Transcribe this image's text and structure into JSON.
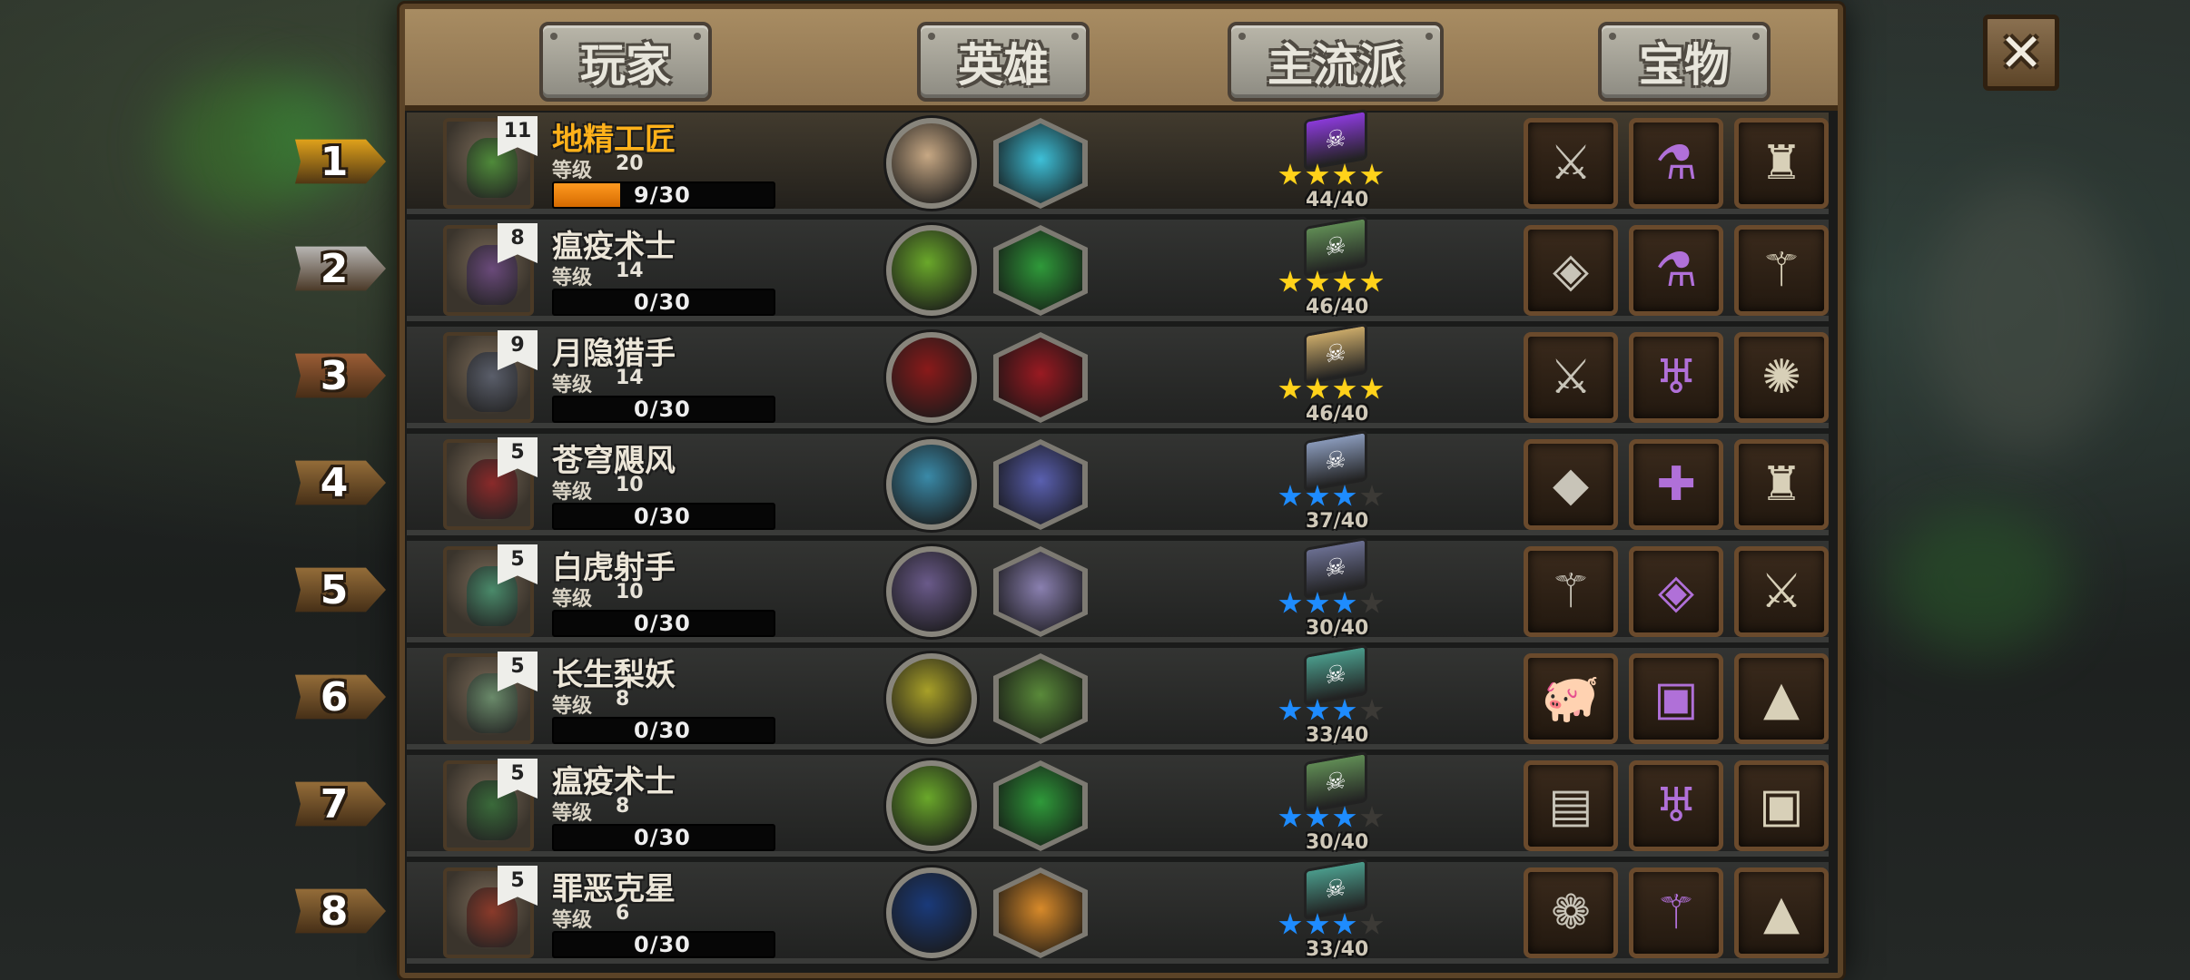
{
  "tabs": [
    "玩家",
    "英雄",
    "主流派",
    "宝物"
  ],
  "close_label": "✕",
  "level_label": "等级",
  "rows": [
    {
      "rank": "1",
      "rank_color": "#f6b21c",
      "hero_level": "11",
      "name": "地精工匠",
      "level": "20",
      "xp": "9/30",
      "xp_fraction": 0.3,
      "round_icon": "gear-icon",
      "round_color": "#c7a884",
      "hex_icon": "tech-arrow-icon",
      "hex_color": "#3ec0d8",
      "book_color": "#8a3ad8",
      "stars": [
        "gold",
        "gold",
        "gold",
        "gold"
      ],
      "score": "44/40",
      "items": [
        {
          "name": "spear-icon",
          "glyph": "⚔"
        },
        {
          "name": "purple-potion-icon",
          "glyph": "⚗"
        },
        {
          "name": "stone-statue-icon",
          "glyph": "♜"
        }
      ],
      "portrait_color": "#4f8a3a"
    },
    {
      "rank": "2",
      "rank_color": "#c9c9c9",
      "hero_level": "8",
      "name": "瘟疫术士",
      "level": "14",
      "xp": "0/30",
      "xp_fraction": 0,
      "round_icon": "plague-bulb-icon",
      "round_color": "#6aa82a",
      "hex_icon": "green-spores-icon",
      "hex_color": "#2f9a3a",
      "book_color": "#5f8a54",
      "stars": [
        "gold",
        "gold",
        "gold",
        "gold"
      ],
      "score": "46/40",
      "items": [
        {
          "name": "leather-armor-icon",
          "glyph": "◈"
        },
        {
          "name": "green-flask-icon",
          "glyph": "⚗"
        },
        {
          "name": "staff-icon",
          "glyph": "⚚"
        }
      ],
      "portrait_color": "#6a4a7a"
    },
    {
      "rank": "3",
      "rank_color": "#a8643a",
      "hero_level": "9",
      "name": "月隐猎手",
      "level": "14",
      "xp": "0/30",
      "xp_fraction": 0,
      "round_icon": "claw-slash-icon",
      "round_color": "#8a1a1a",
      "hex_icon": "wolf-head-icon",
      "hex_color": "#9a1a22",
      "book_color": "#c8a868",
      "stars": [
        "gold",
        "gold",
        "gold",
        "gold"
      ],
      "score": "46/40",
      "items": [
        {
          "name": "dark-blade-icon",
          "glyph": "⚔"
        },
        {
          "name": "golden-chalice-icon",
          "glyph": "♅"
        },
        {
          "name": "rune-disc-icon",
          "glyph": "✺"
        }
      ],
      "portrait_color": "#5a5e6a"
    },
    {
      "rank": "4",
      "rank_color": "#a0763e",
      "hero_level": "5",
      "name": "苍穹飓风",
      "level": "10",
      "xp": "0/30",
      "xp_fraction": 0,
      "round_icon": "whirlwind-icon",
      "round_color": "#3a8aa8",
      "hex_icon": "blue-gust-icon",
      "hex_color": "#5a60b0",
      "book_color": "#8898b8",
      "stars": [
        "blue",
        "blue",
        "blue",
        "off"
      ],
      "score": "37/40",
      "items": [
        {
          "name": "green-crystal-icon",
          "glyph": "◆"
        },
        {
          "name": "medkit-icon",
          "glyph": "✚"
        },
        {
          "name": "stone-statue-icon",
          "glyph": "♜"
        }
      ],
      "portrait_color": "#8a2a2a"
    },
    {
      "rank": "5",
      "rank_color": "#a0763e",
      "hero_level": "5",
      "name": "白虎射手",
      "level": "10",
      "xp": "0/30",
      "xp_fraction": 0,
      "round_icon": "triple-arrow-icon",
      "round_color": "#6a5a8a",
      "hex_icon": "white-flame-icon",
      "hex_color": "#8a80b0",
      "book_color": "#6a6e90",
      "stars": [
        "blue",
        "blue",
        "blue",
        "off"
      ],
      "score": "30/40",
      "items": [
        {
          "name": "staff-icon",
          "glyph": "⚚"
        },
        {
          "name": "leather-armor-icon",
          "glyph": "◈"
        },
        {
          "name": "spear-icon",
          "glyph": "⚔"
        }
      ],
      "portrait_color": "#4a8a6a"
    },
    {
      "rank": "6",
      "rank_color": "#a0763e",
      "hero_level": "5",
      "name": "长生梨妖",
      "level": "8",
      "xp": "0/30",
      "xp_fraction": 0,
      "round_icon": "pear-spirit-icon",
      "round_color": "#a8a028",
      "hex_icon": "leaf-swirl-icon",
      "hex_color": "#5a8a3a",
      "book_color": "#4a9a8a",
      "stars": [
        "blue",
        "blue",
        "blue",
        "off"
      ],
      "score": "33/40",
      "items": [
        {
          "name": "piggy-bank-icon",
          "glyph": "🐖"
        },
        {
          "name": "meat-crate-icon",
          "glyph": "▣"
        },
        {
          "name": "red-hood-icon",
          "glyph": "▲"
        }
      ],
      "portrait_color": "#6a8a6a"
    },
    {
      "rank": "7",
      "rank_color": "#a0763e",
      "hero_level": "5",
      "name": "瘟疫术士",
      "level": "8",
      "xp": "0/30",
      "xp_fraction": 0,
      "round_icon": "plague-bulb-icon",
      "round_color": "#6aa82a",
      "hex_icon": "green-spores-icon",
      "hex_color": "#2f9a3a",
      "book_color": "#5f8a54",
      "stars": [
        "blue",
        "blue",
        "blue",
        "off"
      ],
      "score": "30/40",
      "items": [
        {
          "name": "bookshelf-icon",
          "glyph": "▤"
        },
        {
          "name": "golden-chalice-icon",
          "glyph": "♅"
        },
        {
          "name": "meat-crate-icon",
          "glyph": "▣"
        }
      ],
      "portrait_color": "#3a6a3a"
    },
    {
      "rank": "8",
      "rank_color": "#a0763e",
      "hero_level": "5",
      "name": "罪恶克星",
      "level": "6",
      "xp": "0/30",
      "xp_fraction": 0,
      "round_icon": "blue-star-icon",
      "round_color": "#1a3a7a",
      "hex_icon": "sunburst-icon",
      "hex_color": "#d88a2a",
      "book_color": "#4a9a8a",
      "stars": [
        "blue",
        "blue",
        "blue",
        "off"
      ],
      "score": "33/40",
      "items": [
        {
          "name": "brain-coral-icon",
          "glyph": "❁"
        },
        {
          "name": "staff-icon",
          "glyph": "⚚"
        },
        {
          "name": "red-hood-icon",
          "glyph": "▲"
        }
      ],
      "portrait_color": "#8a3a2a"
    }
  ]
}
